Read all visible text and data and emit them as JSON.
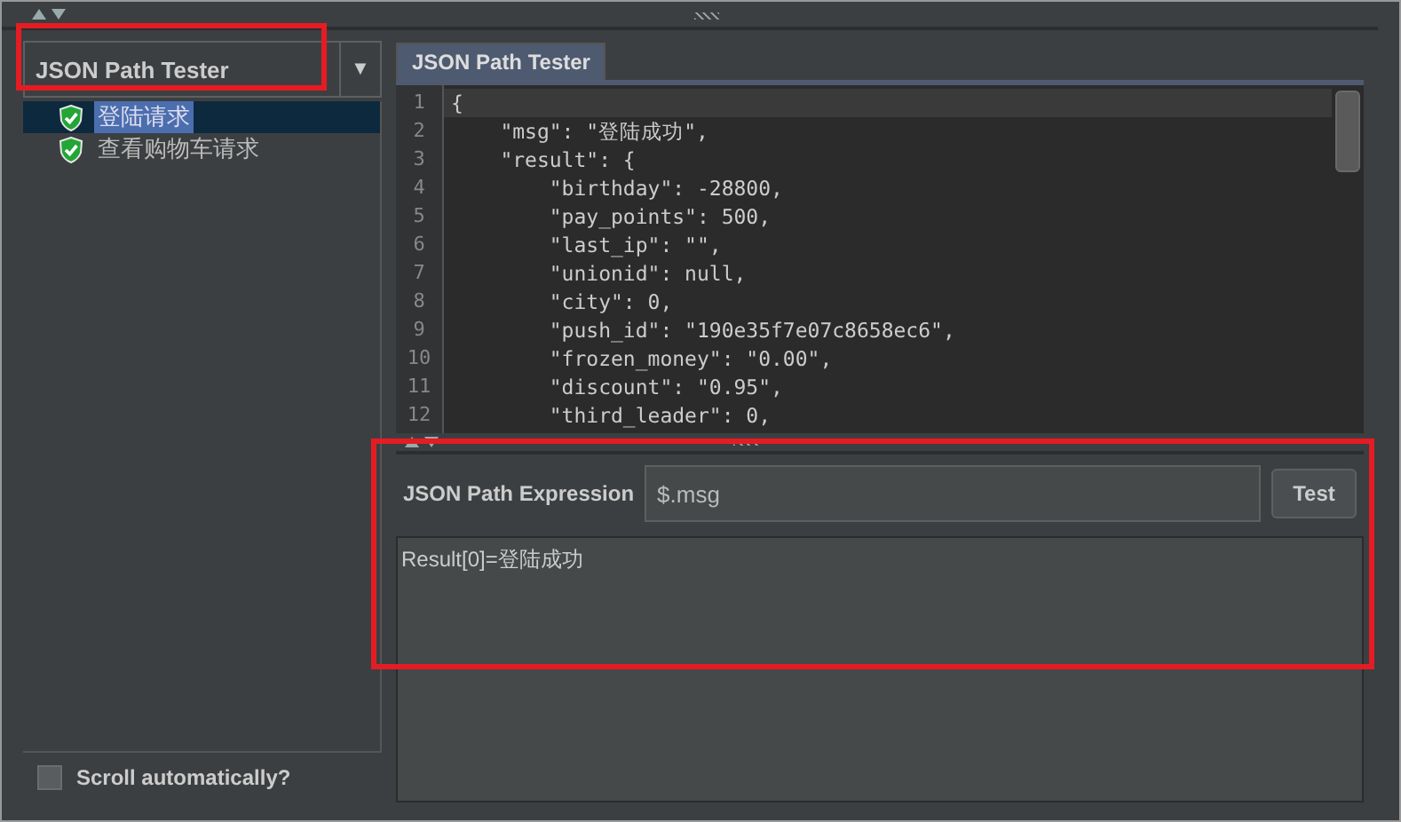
{
  "selector": {
    "value": "JSON Path Tester",
    "arrow": "▼"
  },
  "tree": {
    "items": [
      {
        "label": "登陆请求",
        "selected": true
      },
      {
        "label": "查看购物车请求",
        "selected": false
      }
    ]
  },
  "scroll_checkbox": {
    "label": "Scroll automatically?",
    "checked": false
  },
  "tabs": [
    {
      "label": "JSON Path Tester",
      "selected": true
    }
  ],
  "editor": {
    "lines": [
      {
        "number": "1",
        "text": "{",
        "current": true
      },
      {
        "number": "2",
        "text": "    \"msg\": \"登陆成功\",",
        "current": false
      },
      {
        "number": "3",
        "text": "    \"result\": {",
        "current": false
      },
      {
        "number": "4",
        "text": "        \"birthday\": -28800,",
        "current": false
      },
      {
        "number": "5",
        "text": "        \"pay_points\": 500,",
        "current": false
      },
      {
        "number": "6",
        "text": "        \"last_ip\": \"\",",
        "current": false
      },
      {
        "number": "7",
        "text": "        \"unionid\": null,",
        "current": false
      },
      {
        "number": "8",
        "text": "        \"city\": 0,",
        "current": false
      },
      {
        "number": "9",
        "text": "        \"push_id\": \"190e35f7e07c8658ec6\",",
        "current": false
      },
      {
        "number": "10",
        "text": "        \"frozen_money\": \"0.00\",",
        "current": false
      },
      {
        "number": "11",
        "text": "        \"discount\": \"0.95\",",
        "current": false
      },
      {
        "number": "12",
        "text": "        \"third_leader\": 0,",
        "current": false
      }
    ]
  },
  "expression": {
    "label": "JSON Path Expression",
    "value": "$.msg",
    "button": "Test"
  },
  "result": {
    "text": "Result[0]=登陆成功"
  }
}
